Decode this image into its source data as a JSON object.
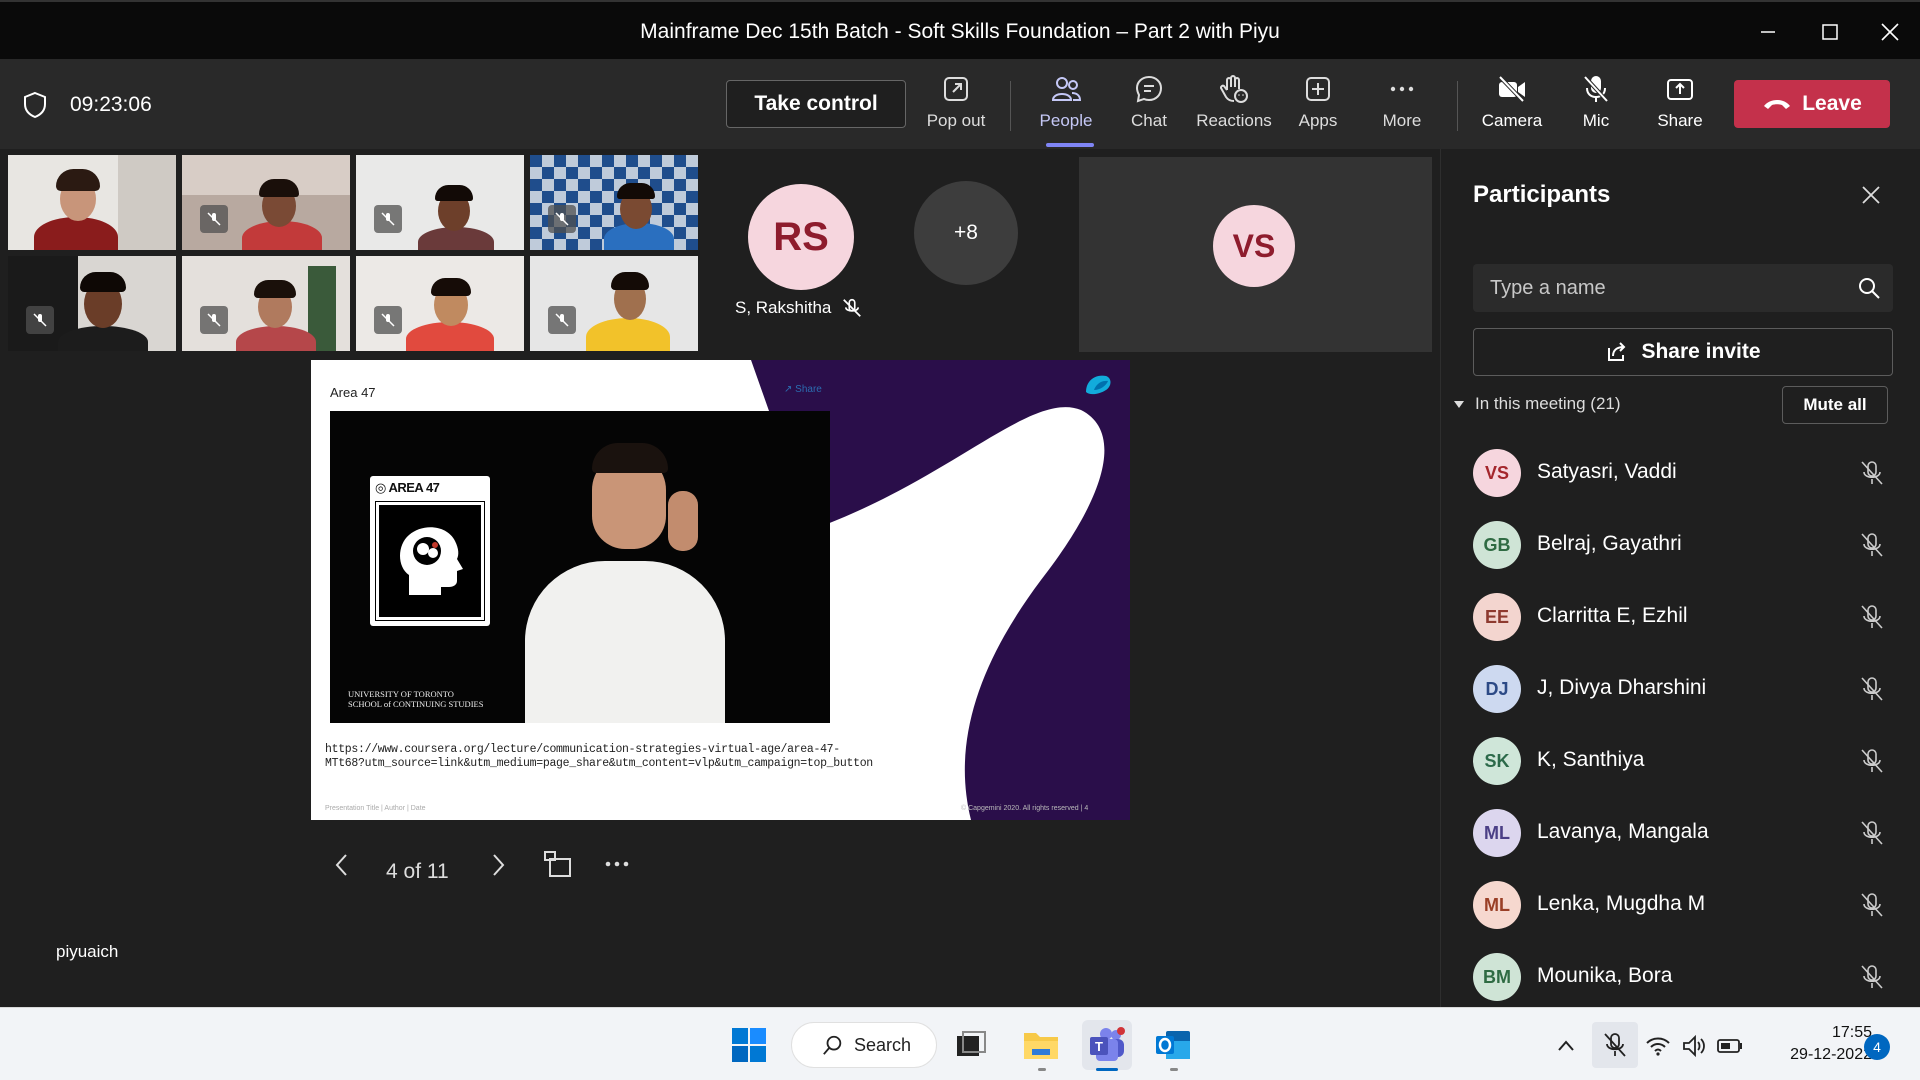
{
  "window": {
    "title": "Mainframe Dec 15th Batch - Soft Skills Foundation – Part 2 with Piyu"
  },
  "toolbar": {
    "timer": "09:23:06",
    "take_control": "Take control",
    "items": [
      {
        "label": "Pop out",
        "icon": "pop-out-icon"
      },
      {
        "label": "People",
        "icon": "people-icon"
      },
      {
        "label": "Chat",
        "icon": "chat-icon"
      },
      {
        "label": "Reactions",
        "icon": "reactions-icon"
      },
      {
        "label": "Apps",
        "icon": "apps-icon"
      },
      {
        "label": "More",
        "icon": "more-icon"
      },
      {
        "label": "Camera",
        "icon": "camera-off-icon"
      },
      {
        "label": "Mic",
        "icon": "mic-off-icon"
      },
      {
        "label": "Share",
        "icon": "share-icon"
      }
    ],
    "leave": "Leave"
  },
  "stage": {
    "tile_rs_initials": "RS",
    "tile_rs_name": "S, Rakshitha",
    "overflow_count": "+8",
    "tile_vs_initials": "VS",
    "presenter_name": "piyuaich"
  },
  "slide": {
    "title": "Area 47",
    "share_label": "Share",
    "logo_text": "AREA 47",
    "university_line1": "UNIVERSITY OF TORONTO",
    "university_line2": "SCHOOL of CONTINUING STUDIES",
    "url_line1": "https://www.coursera.org/lecture/communication-strategies-virtual-age/area-47-",
    "url_line2": "MTt68?utm_source=link&utm_medium=page_share&utm_content=vlp&utm_campaign=top_button",
    "footer_left": "Presentation Title | Author | Date",
    "footer_right": "© Capgemini 2020. All rights reserved |   4",
    "page_indicator": "4 of 11"
  },
  "participants": {
    "title": "Participants",
    "search_placeholder": "Type a name",
    "share_invite": "Share invite",
    "in_meeting": "In this meeting (21)",
    "mute_all": "Mute all",
    "list": [
      {
        "initials": "VS",
        "name": "Satyasri, Vaddi",
        "bg": "#f6d6de",
        "fg": "#a4262c"
      },
      {
        "initials": "GB",
        "name": "Belraj, Gayathri",
        "bg": "#cfe4d6",
        "fg": "#2f6b43"
      },
      {
        "initials": "EE",
        "name": "Clarritta E, Ezhil",
        "bg": "#f3d5cf",
        "fg": "#8e3a2f"
      },
      {
        "initials": "DJ",
        "name": "J, Divya Dharshini",
        "bg": "#cdd9f0",
        "fg": "#2c4a86"
      },
      {
        "initials": "SK",
        "name": "K, Santhiya",
        "bg": "#cfe6d9",
        "fg": "#2c6a4a"
      },
      {
        "initials": "ML",
        "name": "Lavanya, Mangala",
        "bg": "#dcd6ee",
        "fg": "#4b3f86"
      },
      {
        "initials": "ML",
        "name": "Lenka, Mugdha M",
        "bg": "#f6d8cf",
        "fg": "#9a3f26"
      },
      {
        "initials": "BM",
        "name": "Mounika, Bora",
        "bg": "#cfe4d6",
        "fg": "#2f6b43"
      }
    ]
  },
  "taskbar": {
    "search_label": "Search",
    "time": "17:55",
    "date": "29-12-2022",
    "notifications": "4"
  },
  "colors": {
    "accent": "#7f85f5",
    "leave": "#c4314b",
    "slide_purple": "#2a0e4a"
  }
}
